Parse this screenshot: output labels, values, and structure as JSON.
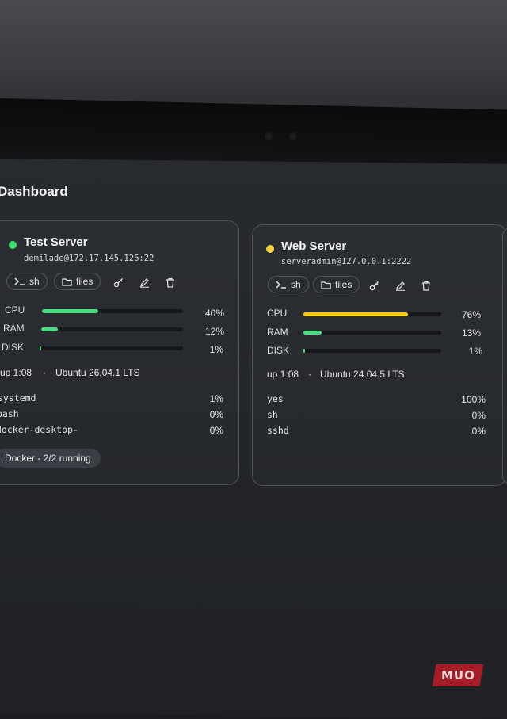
{
  "app": {
    "title": "Dashboard"
  },
  "colors": {
    "online": "#3ddc74",
    "warning": "#f3d33a",
    "bar_green": "#4ade80",
    "bar_yellow": "#facc15"
  },
  "servers": [
    {
      "name": "Test Server",
      "address": "demilade@172.17.145.126:22",
      "status_color": "#3ddc74",
      "actions": {
        "shell_label": "sh",
        "files_label": "files",
        "icons": [
          "key-icon",
          "edit-icon",
          "trash-icon"
        ]
      },
      "metrics": [
        {
          "label": "CPU",
          "value": "40%",
          "fraction": 0.4,
          "color": "#4ade80"
        },
        {
          "label": "RAM",
          "value": "12%",
          "fraction": 0.12,
          "color": "#4ade80"
        },
        {
          "label": "DISK",
          "value": "1%",
          "fraction": 0.01,
          "color": "#4ade80"
        }
      ],
      "uptime": "up 1:08",
      "separator": "·",
      "os": "Ubuntu 26.04.1 LTS",
      "processes": [
        {
          "name": "systemd",
          "value": "1%"
        },
        {
          "name": "bash",
          "value": "0%"
        },
        {
          "name": "docker-desktop-",
          "value": "0%"
        }
      ],
      "docker": "Docker - 2/2 running"
    },
    {
      "name": "Web Server",
      "address": "serveradmin@127.0.0.1:2222",
      "status_color": "#f3d33a",
      "actions": {
        "shell_label": "sh",
        "files_label": "files",
        "icons": [
          "key-icon",
          "edit-icon",
          "trash-icon"
        ]
      },
      "metrics": [
        {
          "label": "CPU",
          "value": "76%",
          "fraction": 0.76,
          "color": "#facc15"
        },
        {
          "label": "RAM",
          "value": "13%",
          "fraction": 0.13,
          "color": "#4ade80"
        },
        {
          "label": "DISK",
          "value": "1%",
          "fraction": 0.01,
          "color": "#4ade80"
        }
      ],
      "uptime": "up 1:08",
      "separator": "·",
      "os": "Ubuntu 24.04.5 LTS",
      "processes": [
        {
          "name": "yes",
          "value": "100%"
        },
        {
          "name": "sh",
          "value": "0%"
        },
        {
          "name": "sshd",
          "value": "0%"
        }
      ]
    }
  ],
  "watermark": "MUO"
}
